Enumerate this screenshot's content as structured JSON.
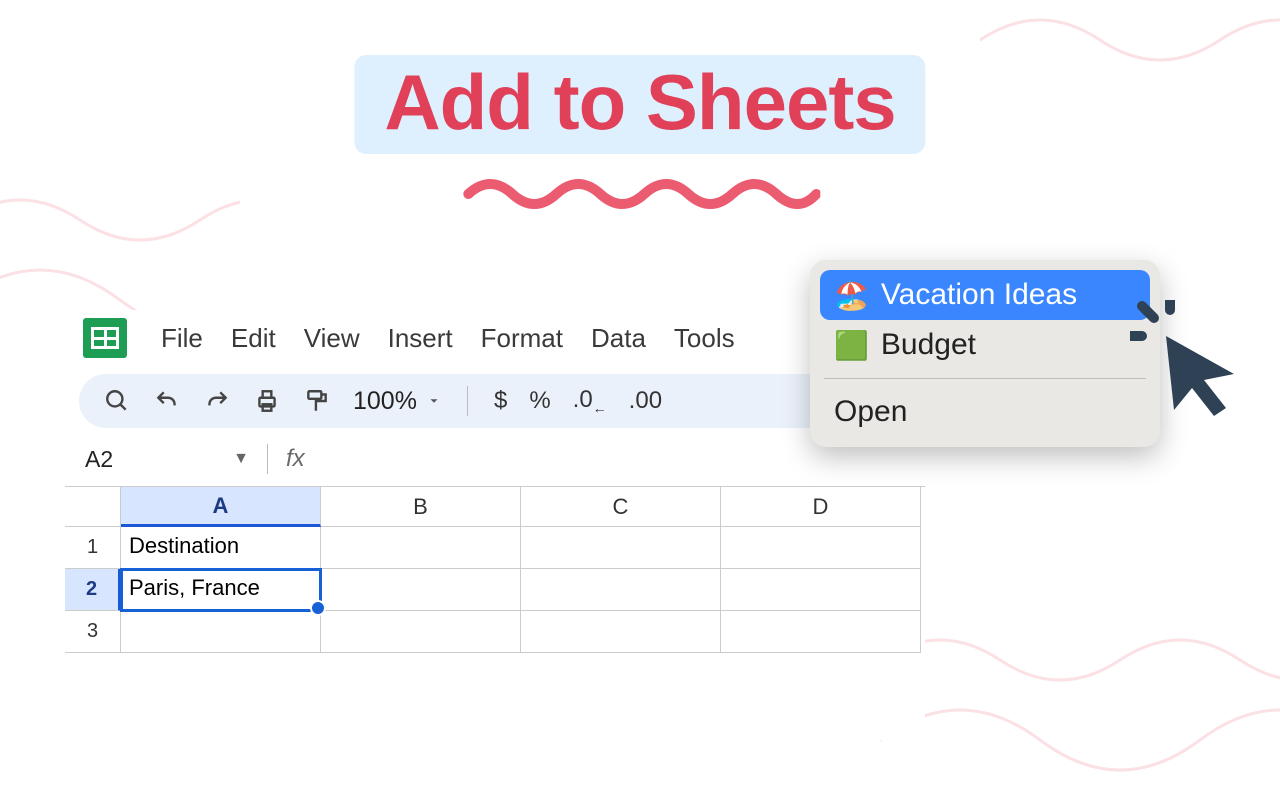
{
  "title": "Add to Sheets",
  "menus": {
    "file": "File",
    "edit": "Edit",
    "view": "View",
    "insert": "Insert",
    "format": "Format",
    "data": "Data",
    "tools": "Tools"
  },
  "toolbar": {
    "zoom": "100%",
    "currency": "$",
    "percent": "%",
    "dec_decrease": ".0",
    "dec_increase": ".00"
  },
  "namebox": "A2",
  "fx_label": "fx",
  "columns": [
    "A",
    "B",
    "C",
    "D"
  ],
  "rows": [
    "1",
    "2",
    "3"
  ],
  "cells": {
    "A1": "Destination",
    "A2": "Paris, France"
  },
  "context_menu": {
    "items": [
      {
        "emoji": "🏖️",
        "label": "Vacation Ideas",
        "selected": true
      },
      {
        "emoji": "🟩",
        "label": "Budget",
        "selected": false
      }
    ],
    "open": "Open"
  }
}
